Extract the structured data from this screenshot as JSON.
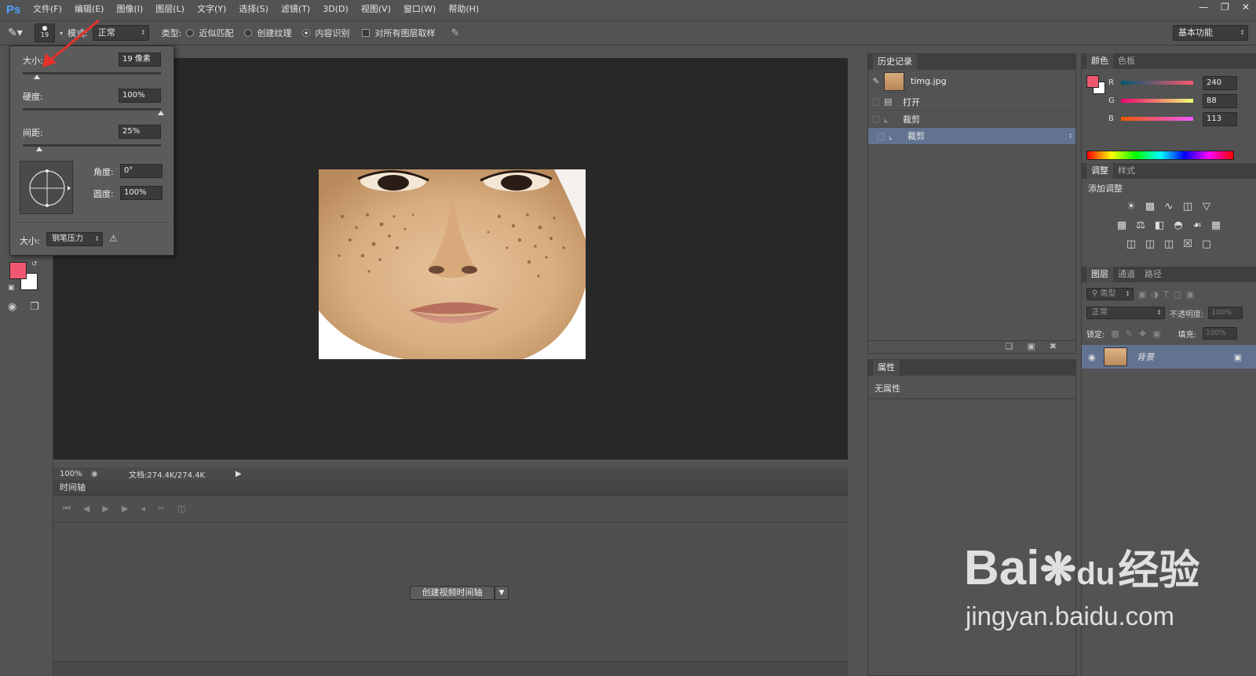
{
  "app": {
    "logo": "Ps"
  },
  "menu": [
    "文件(F)",
    "编辑(E)",
    "图像(I)",
    "图层(L)",
    "文字(Y)",
    "选择(S)",
    "滤镜(T)",
    "3D(D)",
    "视图(V)",
    "窗口(W)",
    "帮助(H)"
  ],
  "window_controls": [
    "minimize-icon",
    "restore-icon",
    "close-icon"
  ],
  "options": {
    "brush_size": "19",
    "mode_label": "模式:",
    "mode_value": "正常",
    "type_label": "类型:",
    "type_options": [
      "近似匹配",
      "创建纹理",
      "内容识别"
    ],
    "type_selected": "内容识别",
    "sample_all_label": "对所有图层取样",
    "workspace": "基本功能"
  },
  "brush_popup": {
    "size_label": "大小:",
    "size_value": "19 像素",
    "size_fraction": 0.1,
    "hardness_label": "硬度:",
    "hardness_value": "100%",
    "hardness_fraction": 1.0,
    "spacing_label": "间距:",
    "spacing_value": "25%",
    "spacing_fraction": 0.12,
    "angle_label": "角度:",
    "angle_value": "0°",
    "roundness_label": "圆度:",
    "roundness_value": "100%",
    "pressure_label": "大小:",
    "pressure_value": "钢笔压力"
  },
  "colors": {
    "foreground": "#f05871",
    "background": "#ffffff",
    "accent_selected": "#627391"
  },
  "status": {
    "zoom": "100%",
    "doc": "文档:274.4K/274.4K"
  },
  "timeline": {
    "title": "时间轴",
    "create_button": "创建视频时间轴"
  },
  "history": {
    "title": "历史记录",
    "snapshot": "timg.jpg",
    "items": [
      {
        "label": "打开",
        "icon": "document-icon"
      },
      {
        "label": "裁剪",
        "icon": "crop-icon"
      },
      {
        "label": "裁剪",
        "icon": "crop-icon",
        "selected": true
      }
    ]
  },
  "properties": {
    "title": "属性",
    "body": "无属性"
  },
  "color_panel": {
    "tabs": [
      "颜色",
      "色板"
    ],
    "r_label": "R",
    "r": "240",
    "g_label": "G",
    "g": "88",
    "b_label": "B",
    "b": "113"
  },
  "adjustments": {
    "tabs": [
      "调整",
      "样式"
    ],
    "add_label": "添加调整"
  },
  "layers": {
    "tabs": [
      "图层",
      "通道",
      "路径"
    ],
    "filter_label": "类型",
    "blend": "正常",
    "opacity_label": "不透明度:",
    "opacity": "100%",
    "lock_label": "锁定:",
    "fill_label": "填充:",
    "fill": "100%",
    "layer_name": "背景"
  },
  "watermark": {
    "brand": "Bai",
    "brand2": "du",
    "cn": "经验",
    "url": "jingyan.baidu.com"
  }
}
